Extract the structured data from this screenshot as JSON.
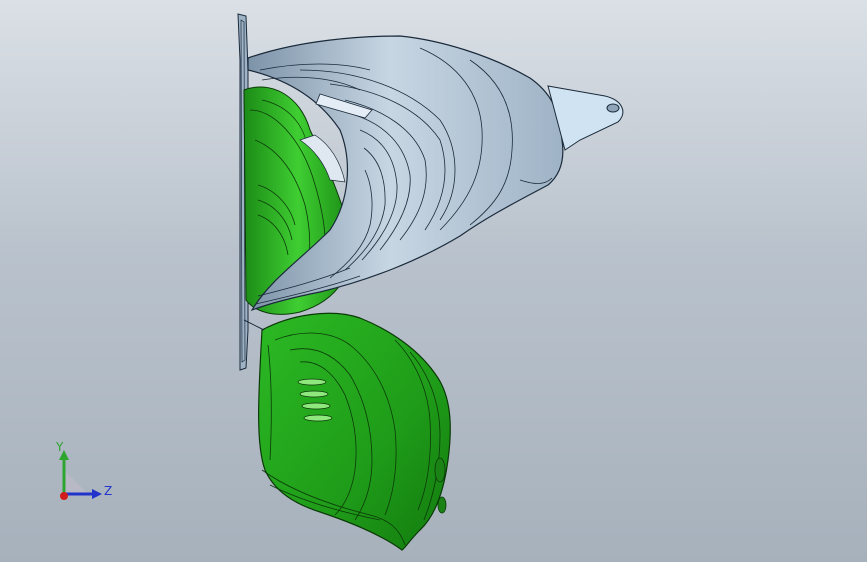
{
  "viewport": {
    "background_top": "#dbe0e6",
    "background_bottom": "#a7b1bc"
  },
  "model": {
    "upper_part_color": "#a9bed0",
    "upper_part_edge": "#1a2a3a",
    "lower_part_color": "#22a81e",
    "lower_part_highlight": "#4fd63f",
    "lower_part_edge": "#0b3a08"
  },
  "triad": {
    "y_label": "Y",
    "z_label": "Z",
    "y_color": "#2ea52e",
    "z_color": "#2233cc",
    "x_color": "#d11c1c"
  }
}
